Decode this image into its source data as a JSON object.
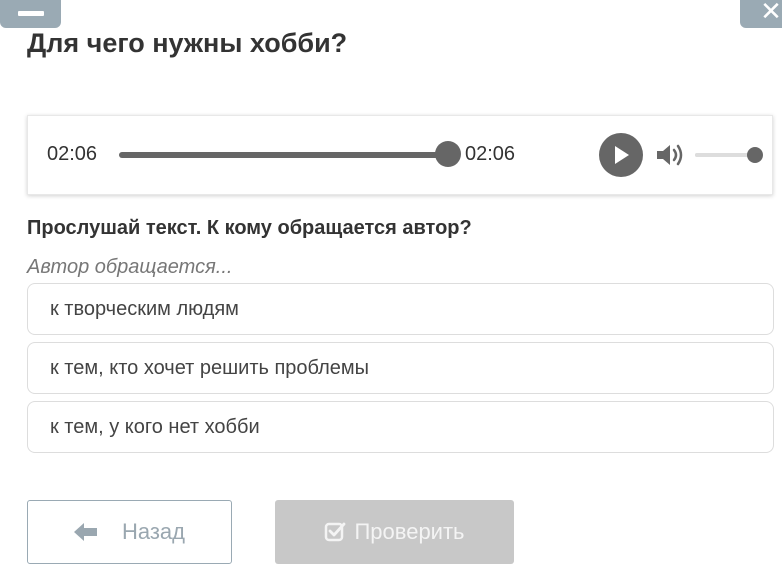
{
  "header": {
    "left_button_icon": "minus-icon",
    "right_button_icon": "close-icon",
    "title": "Для чего нужны хобби?"
  },
  "audio": {
    "current_time": "02:06",
    "total_time": "02:06",
    "progress": 1.0,
    "volume": 1.0,
    "play_icon": "play-icon",
    "volume_icon": "speaker-icon"
  },
  "question": {
    "text": "Прослушай текст. К кому обращается автор?",
    "prompt": "Автор обращается..."
  },
  "options": [
    "к творческим людям",
    "к тем, кто хочет решить проблемы",
    "к тем, у кого нет хобби"
  ],
  "footer": {
    "back_label": "Назад",
    "back_icon": "arrow-left-icon",
    "check_label": "Проверить",
    "check_icon": "checkbox-check-icon"
  },
  "colors": {
    "text": "#333333",
    "control_gray": "#666666",
    "track_gray": "#dddddd",
    "header_button": "#9aaab4",
    "disabled_button": "#c8c8c8"
  }
}
